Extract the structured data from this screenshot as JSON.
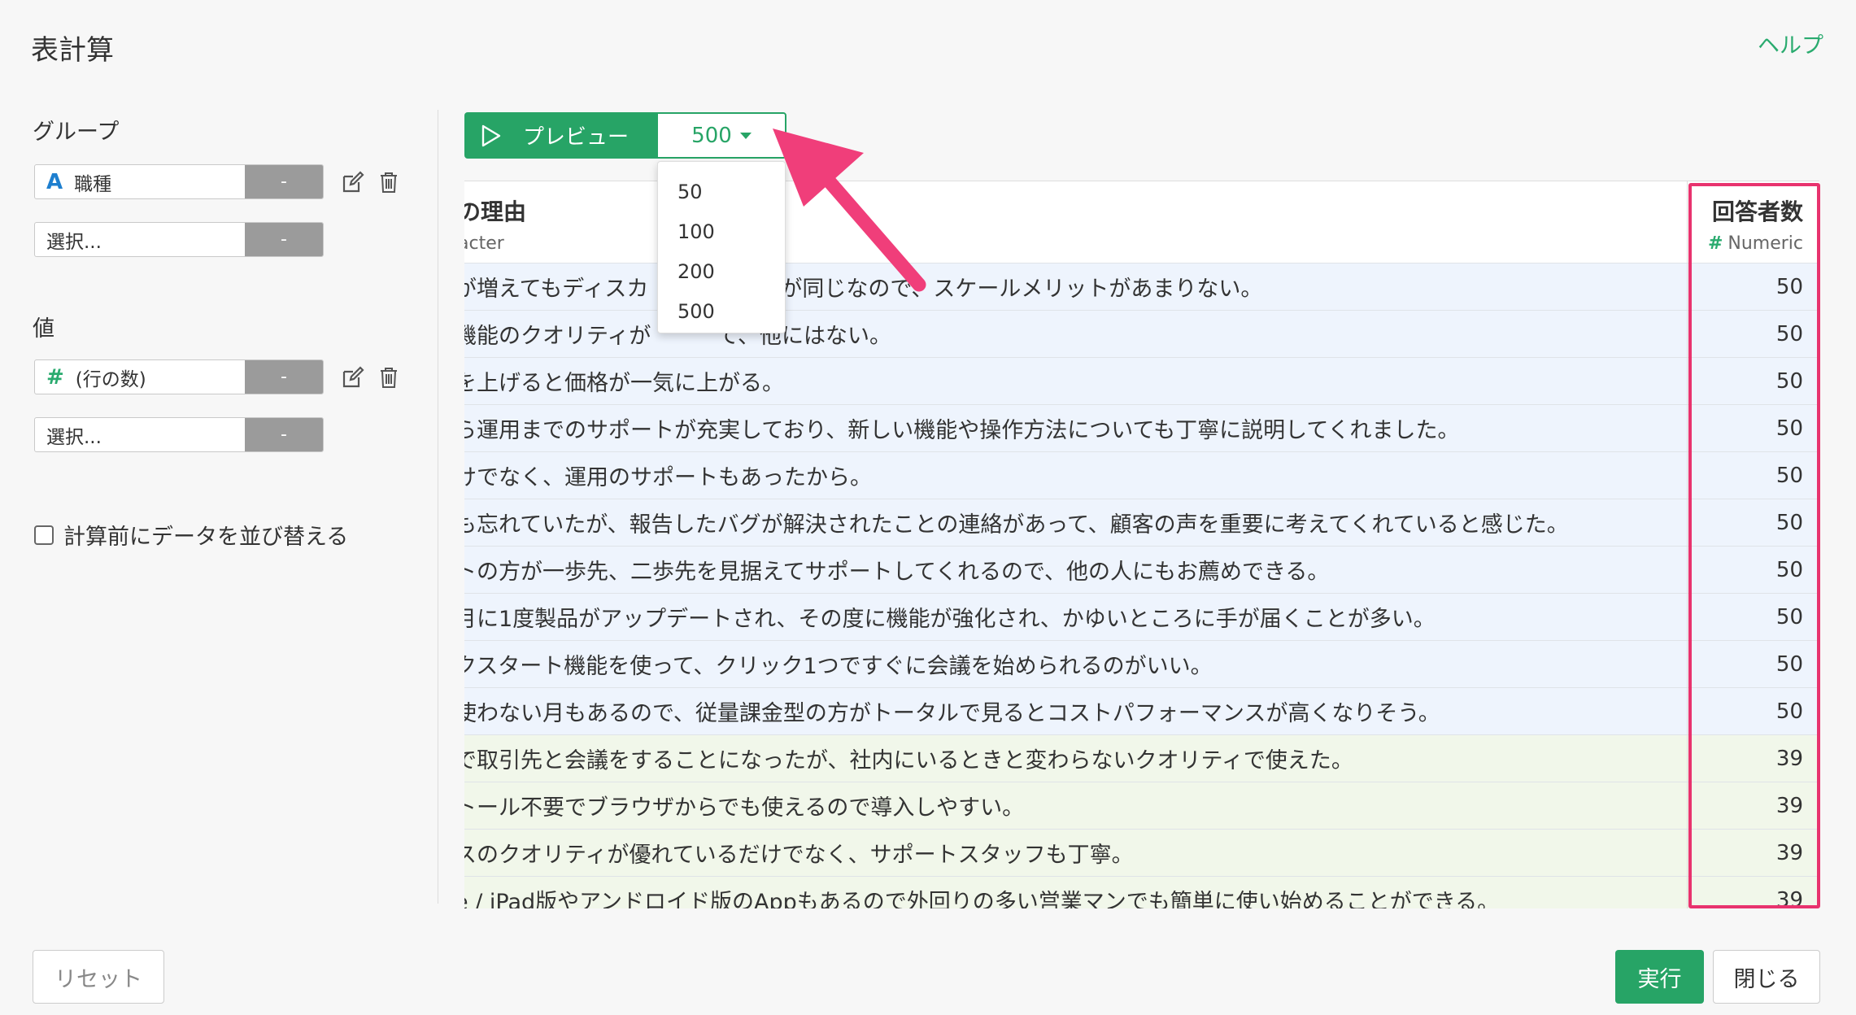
{
  "header": {
    "title": "表計算",
    "help_label": "ヘルプ"
  },
  "sidebar": {
    "group_label": "グループ",
    "group_field": {
      "type_icon": "A",
      "value": "職種",
      "btn": "-"
    },
    "group_select": {
      "value": "選択...",
      "btn": "-"
    },
    "value_label": "値",
    "value_field": {
      "type_icon": "#",
      "value": "(行の数)",
      "btn": "-"
    },
    "value_select": {
      "value": "選択...",
      "btn": "-"
    },
    "sort_option_label": "計算前にデータを並び替える"
  },
  "toolbar": {
    "preview_label": "プレビュー",
    "row_count": "500",
    "row_count_options": [
      "50",
      "100",
      "200",
      "500"
    ]
  },
  "table": {
    "left_header": {
      "title": "の理由",
      "subtitle": "acter"
    },
    "right_header": {
      "title": "回答者数",
      "type_icon": "#",
      "subtitle": "Numeric"
    },
    "rows": [
      {
        "text": "が増えてもディスカ　　　く価格が同じなので、スケールメリットがあまりない。",
        "count": "50",
        "group": "blue"
      },
      {
        "text": "機能のクオリティが　　　て、他にはない。",
        "count": "50",
        "group": "blue"
      },
      {
        "text": "を上げると価格が一気に上がる。",
        "count": "50",
        "group": "blue"
      },
      {
        "text": "ら運用までのサポートが充実しており、新しい機能や操作方法についても丁寧に説明してくれました。",
        "count": "50",
        "group": "blue"
      },
      {
        "text": "けでなく、運用のサポートもあったから。",
        "count": "50",
        "group": "blue"
      },
      {
        "text": "も忘れていたが、報告したバグが解決されたことの連絡があって、顧客の声を重要に考えてくれていると感じた。",
        "count": "50",
        "group": "blue"
      },
      {
        "text": "トの方が一歩先、二歩先を見据えてサポートしてくれるので、他の人にもお薦めできる。",
        "count": "50",
        "group": "blue"
      },
      {
        "text": "月に1度製品がアップデートされ、その度に機能が強化され、かゆいところに手が届くことが多い。",
        "count": "50",
        "group": "blue"
      },
      {
        "text": "クスタート機能を使って、クリック1つですぐに会議を始められるのがいい。",
        "count": "50",
        "group": "blue"
      },
      {
        "text": "使わない月もあるので、従量課金型の方がトータルで見るとコストパフォーマンスが高くなりそう。",
        "count": "50",
        "group": "blue"
      },
      {
        "text": "で取引先と会議をすることになったが、社内にいるときと変わらないクオリティで使えた。",
        "count": "39",
        "group": "green"
      },
      {
        "text": "トール不要でブラウザからでも使えるので導入しやすい。",
        "count": "39",
        "group": "green"
      },
      {
        "text": "スのクオリティが優れているだけでなく、サポートスタッフも丁寧。",
        "count": "39",
        "group": "green"
      },
      {
        "text": "e / iPad版やアンドロイド版のAppもあるので外回りの多い営業マンでも簡単に使い始めることができる。",
        "count": "39",
        "group": "green"
      }
    ]
  },
  "footer": {
    "reset_label": "リセット",
    "run_label": "実行",
    "close_label": "閉じる"
  },
  "colors": {
    "accent": "#27a466",
    "highlight": "#e8336e",
    "char_type": "#1e7fcf"
  }
}
